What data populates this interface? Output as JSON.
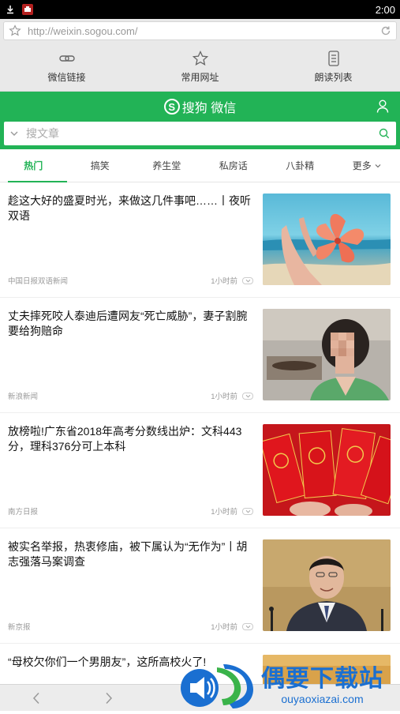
{
  "status_bar": {
    "time": "2:00"
  },
  "browser": {
    "url": "http://weixin.sogou.com/",
    "quick_links": [
      {
        "label": "微信链接",
        "icon": "link-icon"
      },
      {
        "label": "常用网址",
        "icon": "star-icon"
      },
      {
        "label": "朗读列表",
        "icon": "list-icon"
      }
    ]
  },
  "header": {
    "brand": "搜狗 微信",
    "logo_letter": "S"
  },
  "search": {
    "placeholder": "搜文章"
  },
  "tabs": [
    {
      "label": "热门",
      "active": true
    },
    {
      "label": "搞笑"
    },
    {
      "label": "养生堂"
    },
    {
      "label": "私房话"
    },
    {
      "label": "八卦精"
    },
    {
      "label": "更多"
    }
  ],
  "articles": [
    {
      "title": "趁这大好的盛夏时光，来做这几件事吧……丨夜听双语",
      "source": "中国日报双语新闻",
      "time": "1小时前",
      "image": "hand-flower"
    },
    {
      "title": "丈夫摔死咬人泰迪后遭网友“死亡威胁”，妻子割腕要给狗赔命",
      "source": "新浪新闻",
      "time": "1小时前",
      "image": "woman-pixelated"
    },
    {
      "title": "放榜啦!广东省2018年高考分数线出炉：文科443分，理科376分可上本科",
      "source": "南方日报",
      "time": "1小时前",
      "image": "red-envelopes"
    },
    {
      "title": "被实名举报，热衷修庙，被下属认为“无作为”丨胡志强落马案调查",
      "source": "新京报",
      "time": "1小时前",
      "image": "official-portrait"
    },
    {
      "title": "“母校欠你们一个男朋友”，这所高校火了!",
      "source": "",
      "time": "",
      "image": "partial"
    }
  ],
  "watermark": {
    "big": "偶要下载站",
    "small": "ouyaoxiazai.com"
  },
  "colors": {
    "accent": "#22b356",
    "watermark": "#1a6fd1"
  }
}
